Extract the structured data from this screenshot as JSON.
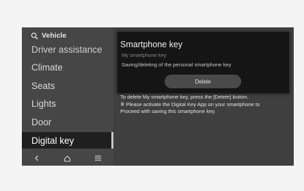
{
  "sidebar": {
    "header": "Vehicle",
    "items": [
      {
        "label": "Driver assistance"
      },
      {
        "label": "Climate"
      },
      {
        "label": "Seats"
      },
      {
        "label": "Lights"
      },
      {
        "label": "Door"
      },
      {
        "label": "Digital key"
      }
    ],
    "nav": {
      "back": "back-icon",
      "home": "home-icon",
      "menu": "menu-icon"
    }
  },
  "popup": {
    "title": "Smartphone key",
    "subtitle": "My smartphone key",
    "description": "Saving/deleting of the personal smartphone key",
    "delete_label": "Delete"
  },
  "content": {
    "lines": [
      "To delete My smartphone key, press the [Delete] button.",
      "※ Please activate the Digital Key App on your smartphone to",
      "Proceed with saving this smartphone key."
    ]
  }
}
